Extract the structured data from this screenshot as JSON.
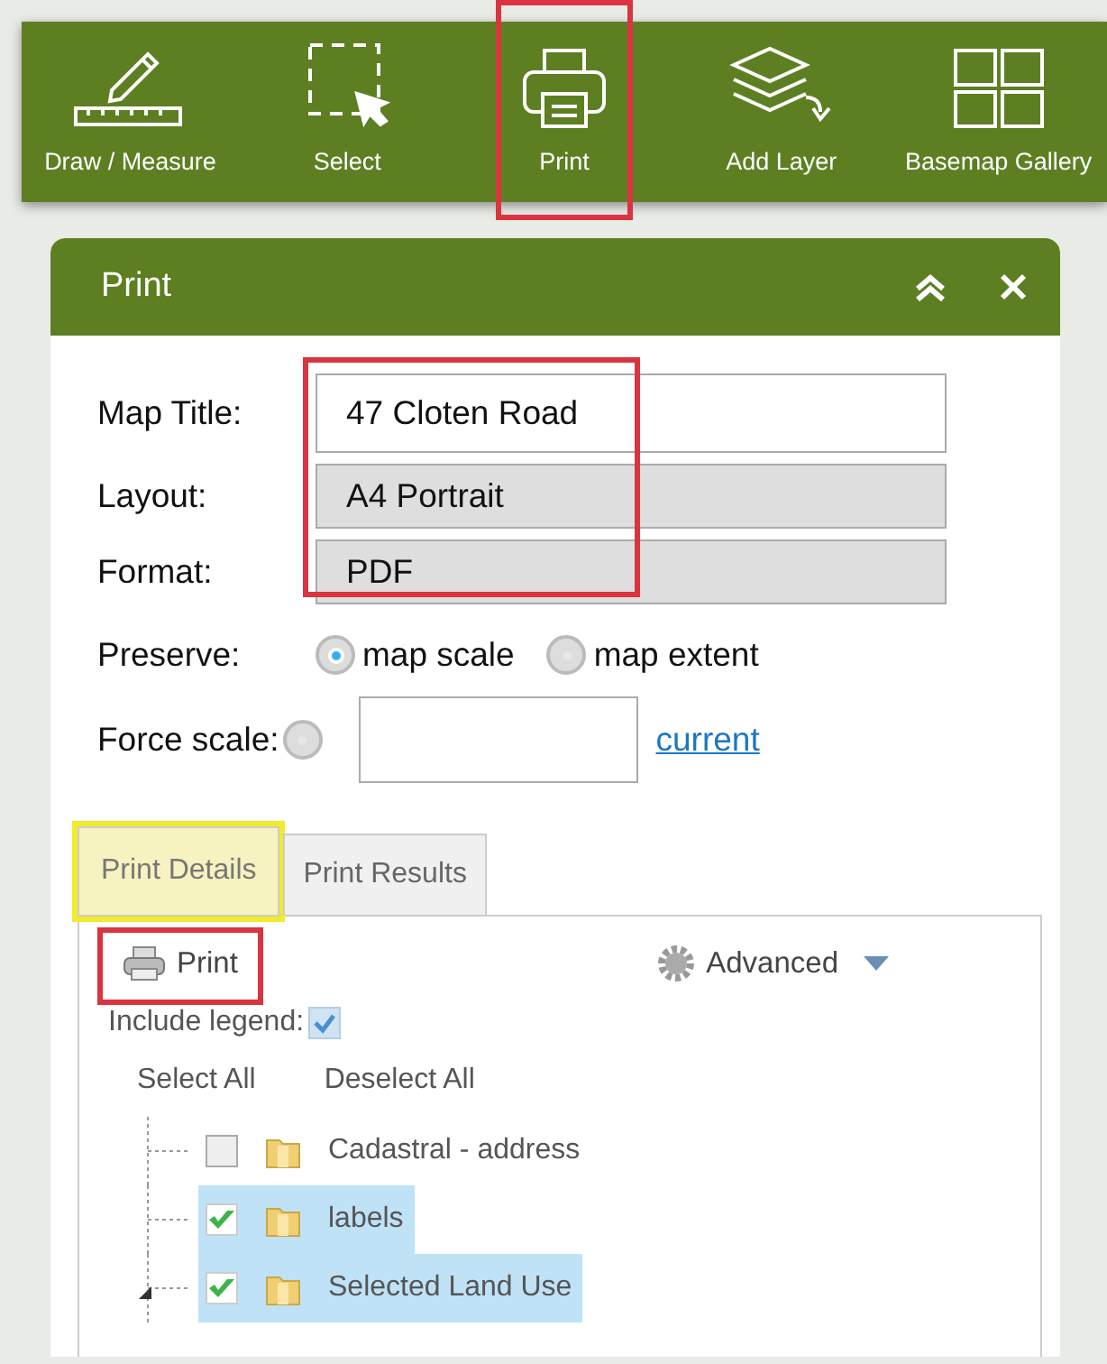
{
  "toolbar": [
    {
      "label": "Draw / Measure",
      "highlighted": false
    },
    {
      "label": "Select",
      "highlighted": false
    },
    {
      "label": "Print",
      "highlighted": true
    },
    {
      "label": "Add Layer",
      "highlighted": false
    },
    {
      "label": "Basemap Gallery",
      "highlighted": false
    }
  ],
  "panel": {
    "title": "Print",
    "form": {
      "fields": [
        {
          "label": "Map Title:",
          "value": "47 Cloten Road",
          "kind": "text"
        },
        {
          "label": "Layout:",
          "value": "A4 Portrait",
          "kind": "select"
        },
        {
          "label": "Format:",
          "value": "PDF",
          "kind": "select"
        }
      ],
      "fields_highlighted": true,
      "preserve": {
        "label": "Preserve:",
        "options": [
          {
            "label": "map scale",
            "selected": true
          },
          {
            "label": "map extent",
            "selected": false
          }
        ]
      },
      "force_scale": {
        "label": "Force scale:",
        "selected": false,
        "link": "current"
      }
    },
    "tabs": [
      {
        "label": "Print Details",
        "selected": true,
        "highlighted": true
      },
      {
        "label": "Print Results",
        "selected": false,
        "highlighted": false
      }
    ],
    "print_button": {
      "label": "Print",
      "highlighted": true
    },
    "advanced": {
      "label": "Advanced"
    },
    "include_legend": {
      "label": "Include legend:",
      "checked": true
    },
    "select_all": "Select All",
    "deselect_all": "Deselect All",
    "layers": [
      {
        "name": "Cadastral - address",
        "checked": false,
        "selected": false,
        "expander": false
      },
      {
        "name": "labels",
        "checked": true,
        "selected": true,
        "expander": false
      },
      {
        "name": "Selected Land Use",
        "checked": true,
        "selected": true,
        "expander": true
      }
    ]
  }
}
